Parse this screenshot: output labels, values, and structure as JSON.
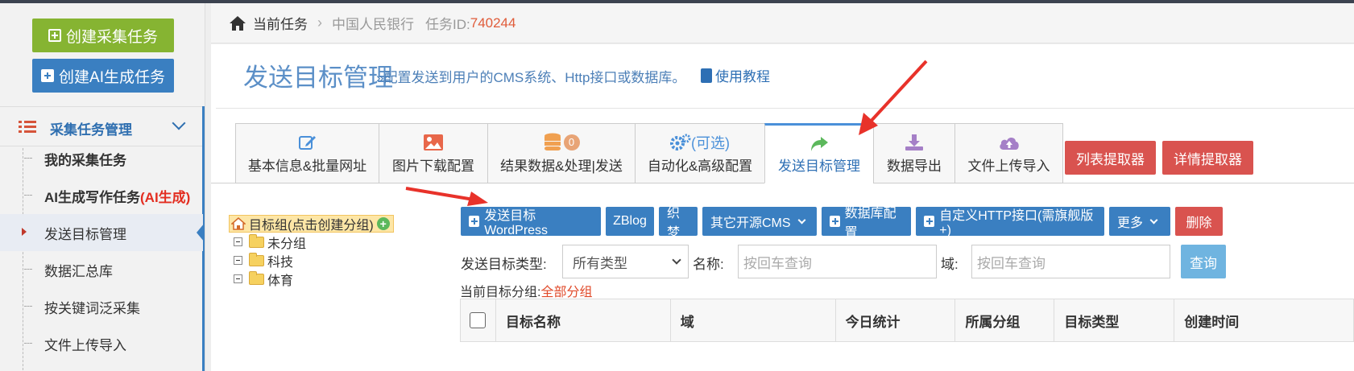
{
  "sidebar": {
    "create_task": "创建采集任务",
    "create_ai_task": "创建AI生成任务",
    "section_title": "采集任务管理",
    "items": [
      {
        "label": "我的采集任务",
        "suffix": ""
      },
      {
        "label": "AI生成写作任务",
        "suffix": "(AI生成)"
      },
      {
        "label": "发送目标管理",
        "suffix": ""
      },
      {
        "label": "数据汇总库",
        "suffix": ""
      },
      {
        "label": "按关键词泛采集",
        "suffix": ""
      },
      {
        "label": "文件上传导入",
        "suffix": ""
      }
    ]
  },
  "breadcrumb": {
    "current": "当前任务",
    "bank": "中国人民银行",
    "id_label": "任务ID:",
    "id_value": "740244"
  },
  "header": {
    "title": "发送目标管理",
    "desc": "»配置发送到用户的CMS系统、Http接口或数据库。",
    "tutorial": "使用教程"
  },
  "tabs": [
    {
      "label": "基本信息&批量网址",
      "icon": "edit-icon",
      "color": "#4a90d9"
    },
    {
      "label": "图片下载配置",
      "icon": "image-icon",
      "color": "#e8674a"
    },
    {
      "label": "结果数据&处理|发送",
      "icon": "database-icon",
      "color": "#f0a050",
      "badge": "0"
    },
    {
      "label": "自动化&高级配置",
      "icon": "gears-icon",
      "color": "#4a90d9",
      "extra": "(可选)"
    },
    {
      "label": "发送目标管理",
      "icon": "share-icon",
      "color": "#5cb85c"
    },
    {
      "label": "数据导出",
      "icon": "download-icon",
      "color": "#a57fc7"
    },
    {
      "label": "文件上传导入",
      "icon": "cloud-upload-icon",
      "color": "#a57fc7"
    }
  ],
  "extra_buttons": {
    "list_extractor": "列表提取器",
    "detail_extractor": "详情提取器"
  },
  "tree": {
    "root": "目标组(点击创建分组)",
    "nodes": [
      "未分组",
      "科技",
      "体育"
    ]
  },
  "toolbar": {
    "wordpress": "发送目标WordPress",
    "zblog": "ZBlog",
    "dede": "织梦",
    "other_cms": "其它开源CMS",
    "db_config": "数据库配置",
    "http": "自定义HTTP接口(需旗舰版+)",
    "more": "更多",
    "delete": "删除"
  },
  "filter": {
    "type_label": "发送目标类型:",
    "type_value": "所有类型",
    "name_label": "名称:",
    "name_placeholder": "按回车查询",
    "domain_label": "域:",
    "domain_placeholder": "按回车查询",
    "query": "查询"
  },
  "group_info": {
    "label": "当前目标分组:",
    "value": "全部分组"
  },
  "table": {
    "columns": [
      "目标名称",
      "域",
      "今日统计",
      "所属分组",
      "目标类型",
      "创建时间"
    ]
  },
  "colors": {
    "accent": "#3a7fc1",
    "green": "#86b432",
    "danger": "#d9534f",
    "annotation": "#e8322a"
  }
}
